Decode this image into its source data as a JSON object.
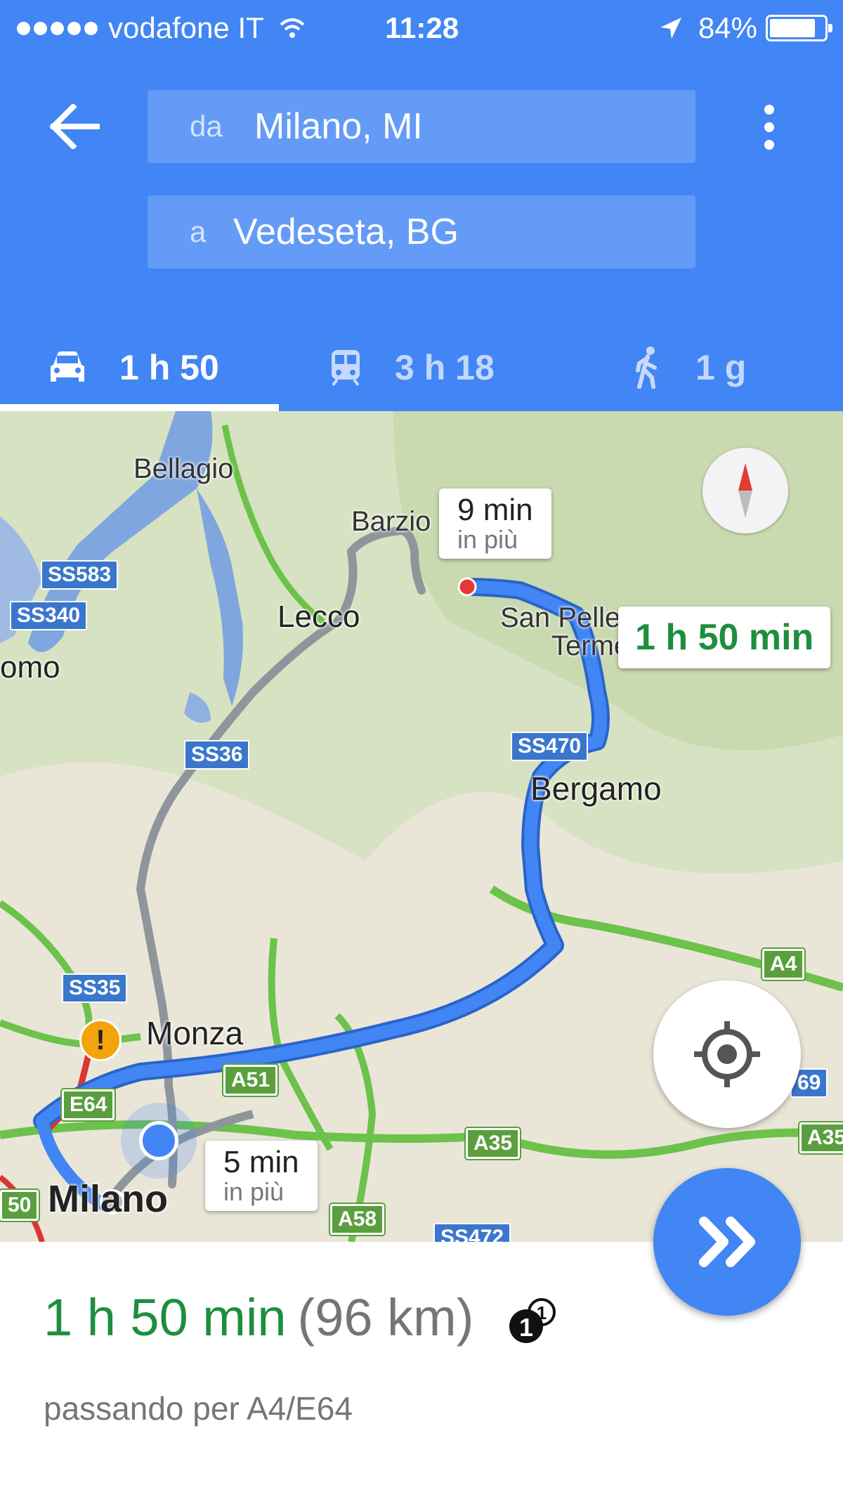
{
  "status_bar": {
    "carrier": "vodafone IT",
    "time": "11:28",
    "battery": "84%",
    "battery_level": 0.84
  },
  "directions": {
    "from_label": "da",
    "from_value": "Milano, MI",
    "to_label": "a",
    "to_value": "Vedeseta, BG"
  },
  "modes": [
    {
      "label": "1 h 50",
      "icon": "car-icon",
      "active": true
    },
    {
      "label": "3 h 18",
      "icon": "train-icon",
      "active": false
    },
    {
      "label": "1 g",
      "icon": "walk-icon",
      "active": false
    }
  ],
  "map": {
    "places": {
      "bellagio": "Bellagio",
      "barzio": "Barzio",
      "lecco": "Lecco",
      "como": "omo",
      "san_pellegrino": "San Pelle",
      "terme": "Terme",
      "bergamo": "Bergamo",
      "monza": "Monza",
      "milano": "Milano"
    },
    "roads": {
      "ss583": "SS583",
      "ss340": "SS340",
      "ss36": "SS36",
      "ss470": "SS470",
      "ss35": "SS35",
      "e64": "E64",
      "a51": "A51",
      "a4": "A4",
      "a35": "A35",
      "a35_right": "A35",
      "a58": "A58",
      "ss472": "SS472",
      "left_50": "50",
      "right_69": "69"
    },
    "alt_bubble_top": {
      "time": "9 min",
      "note": "in più"
    },
    "alt_bubble_bottom": {
      "time": "5 min",
      "note": "in più"
    },
    "main_bubble": "1 h 50 min",
    "route_color": "#4285f4",
    "alt_route_color": "#9aa0a6"
  },
  "summary": {
    "duration": "1 h 50 min",
    "distance": "(96 km)",
    "via": "passando per A4/E64"
  },
  "colors": {
    "brand_blue": "#4285f4",
    "duration_green": "#1e8e3e"
  }
}
